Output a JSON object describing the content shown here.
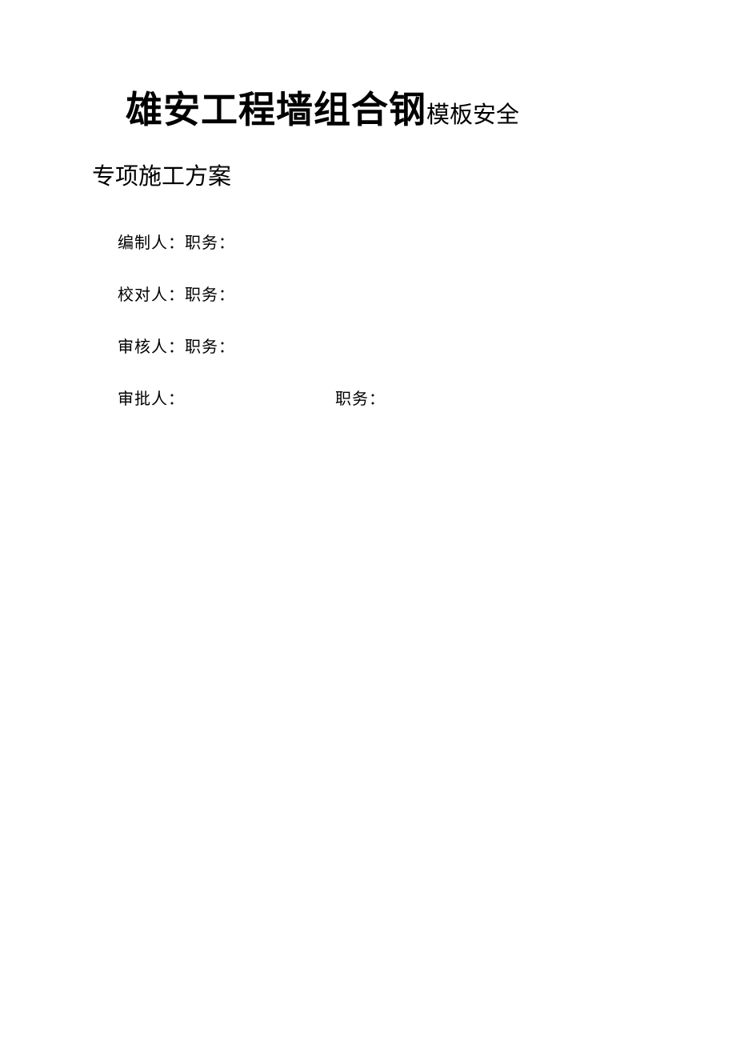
{
  "title": {
    "large": "雄安工程墙组合钢",
    "medium": "模板安全"
  },
  "subtitle": "专项施工方案",
  "info": {
    "line1": "编制人：职务：",
    "line2": "校对人：职务：",
    "line3": "审核人：职务：",
    "line4_left": "审批人：",
    "line4_right": "职务："
  }
}
